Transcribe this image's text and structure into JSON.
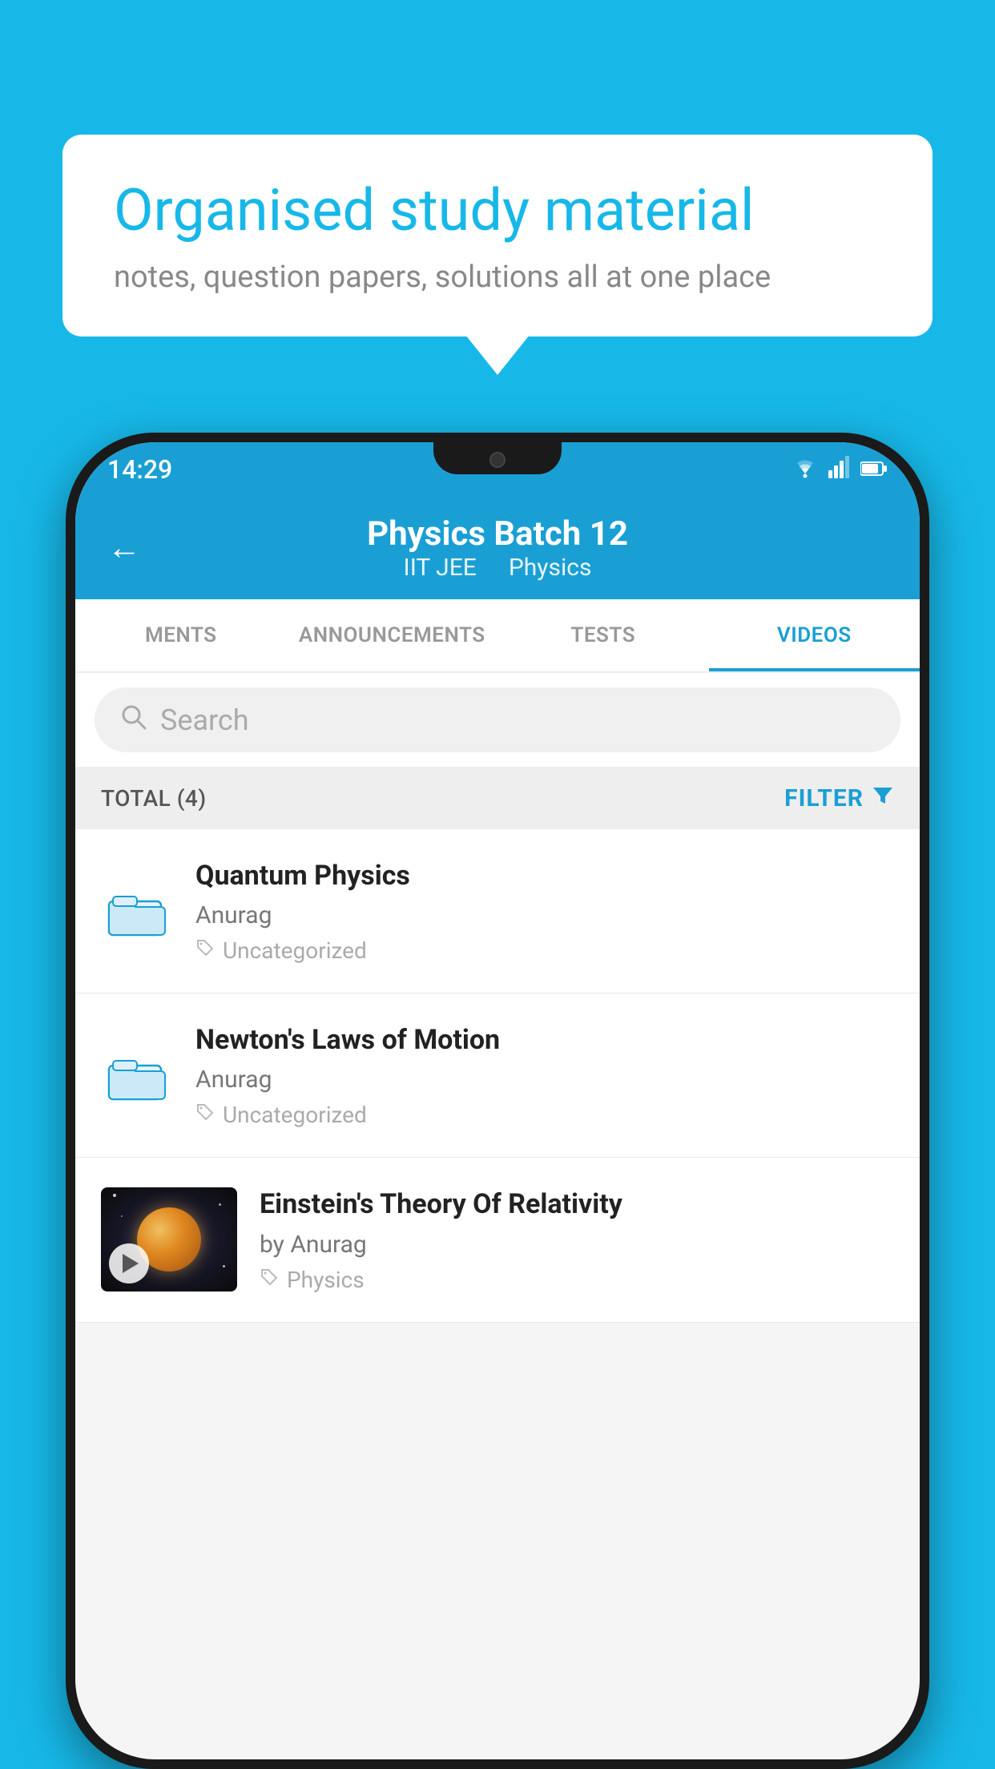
{
  "background_color": "#17b8e8",
  "bubble": {
    "title": "Organised study material",
    "subtitle": "notes, question papers, solutions all at one place"
  },
  "status_bar": {
    "time": "14:29",
    "wifi": "▾",
    "signal": "▲",
    "battery": "▮"
  },
  "header": {
    "back_label": "←",
    "title": "Physics Batch 12",
    "tag1": "IIT JEE",
    "tag2": "Physics"
  },
  "tabs": [
    {
      "label": "MENTS",
      "active": false
    },
    {
      "label": "ANNOUNCEMENTS",
      "active": false
    },
    {
      "label": "TESTS",
      "active": false
    },
    {
      "label": "VIDEOS",
      "active": true
    }
  ],
  "search": {
    "placeholder": "Search"
  },
  "filter_bar": {
    "total_label": "TOTAL (4)",
    "filter_label": "FILTER"
  },
  "videos": [
    {
      "id": 1,
      "title": "Quantum Physics",
      "author": "Anurag",
      "tag": "Uncategorized",
      "has_thumb": false
    },
    {
      "id": 2,
      "title": "Newton's Laws of Motion",
      "author": "Anurag",
      "tag": "Uncategorized",
      "has_thumb": false
    },
    {
      "id": 3,
      "title": "Einstein's Theory Of Relativity",
      "author": "by Anurag",
      "tag": "Physics",
      "has_thumb": true
    }
  ]
}
